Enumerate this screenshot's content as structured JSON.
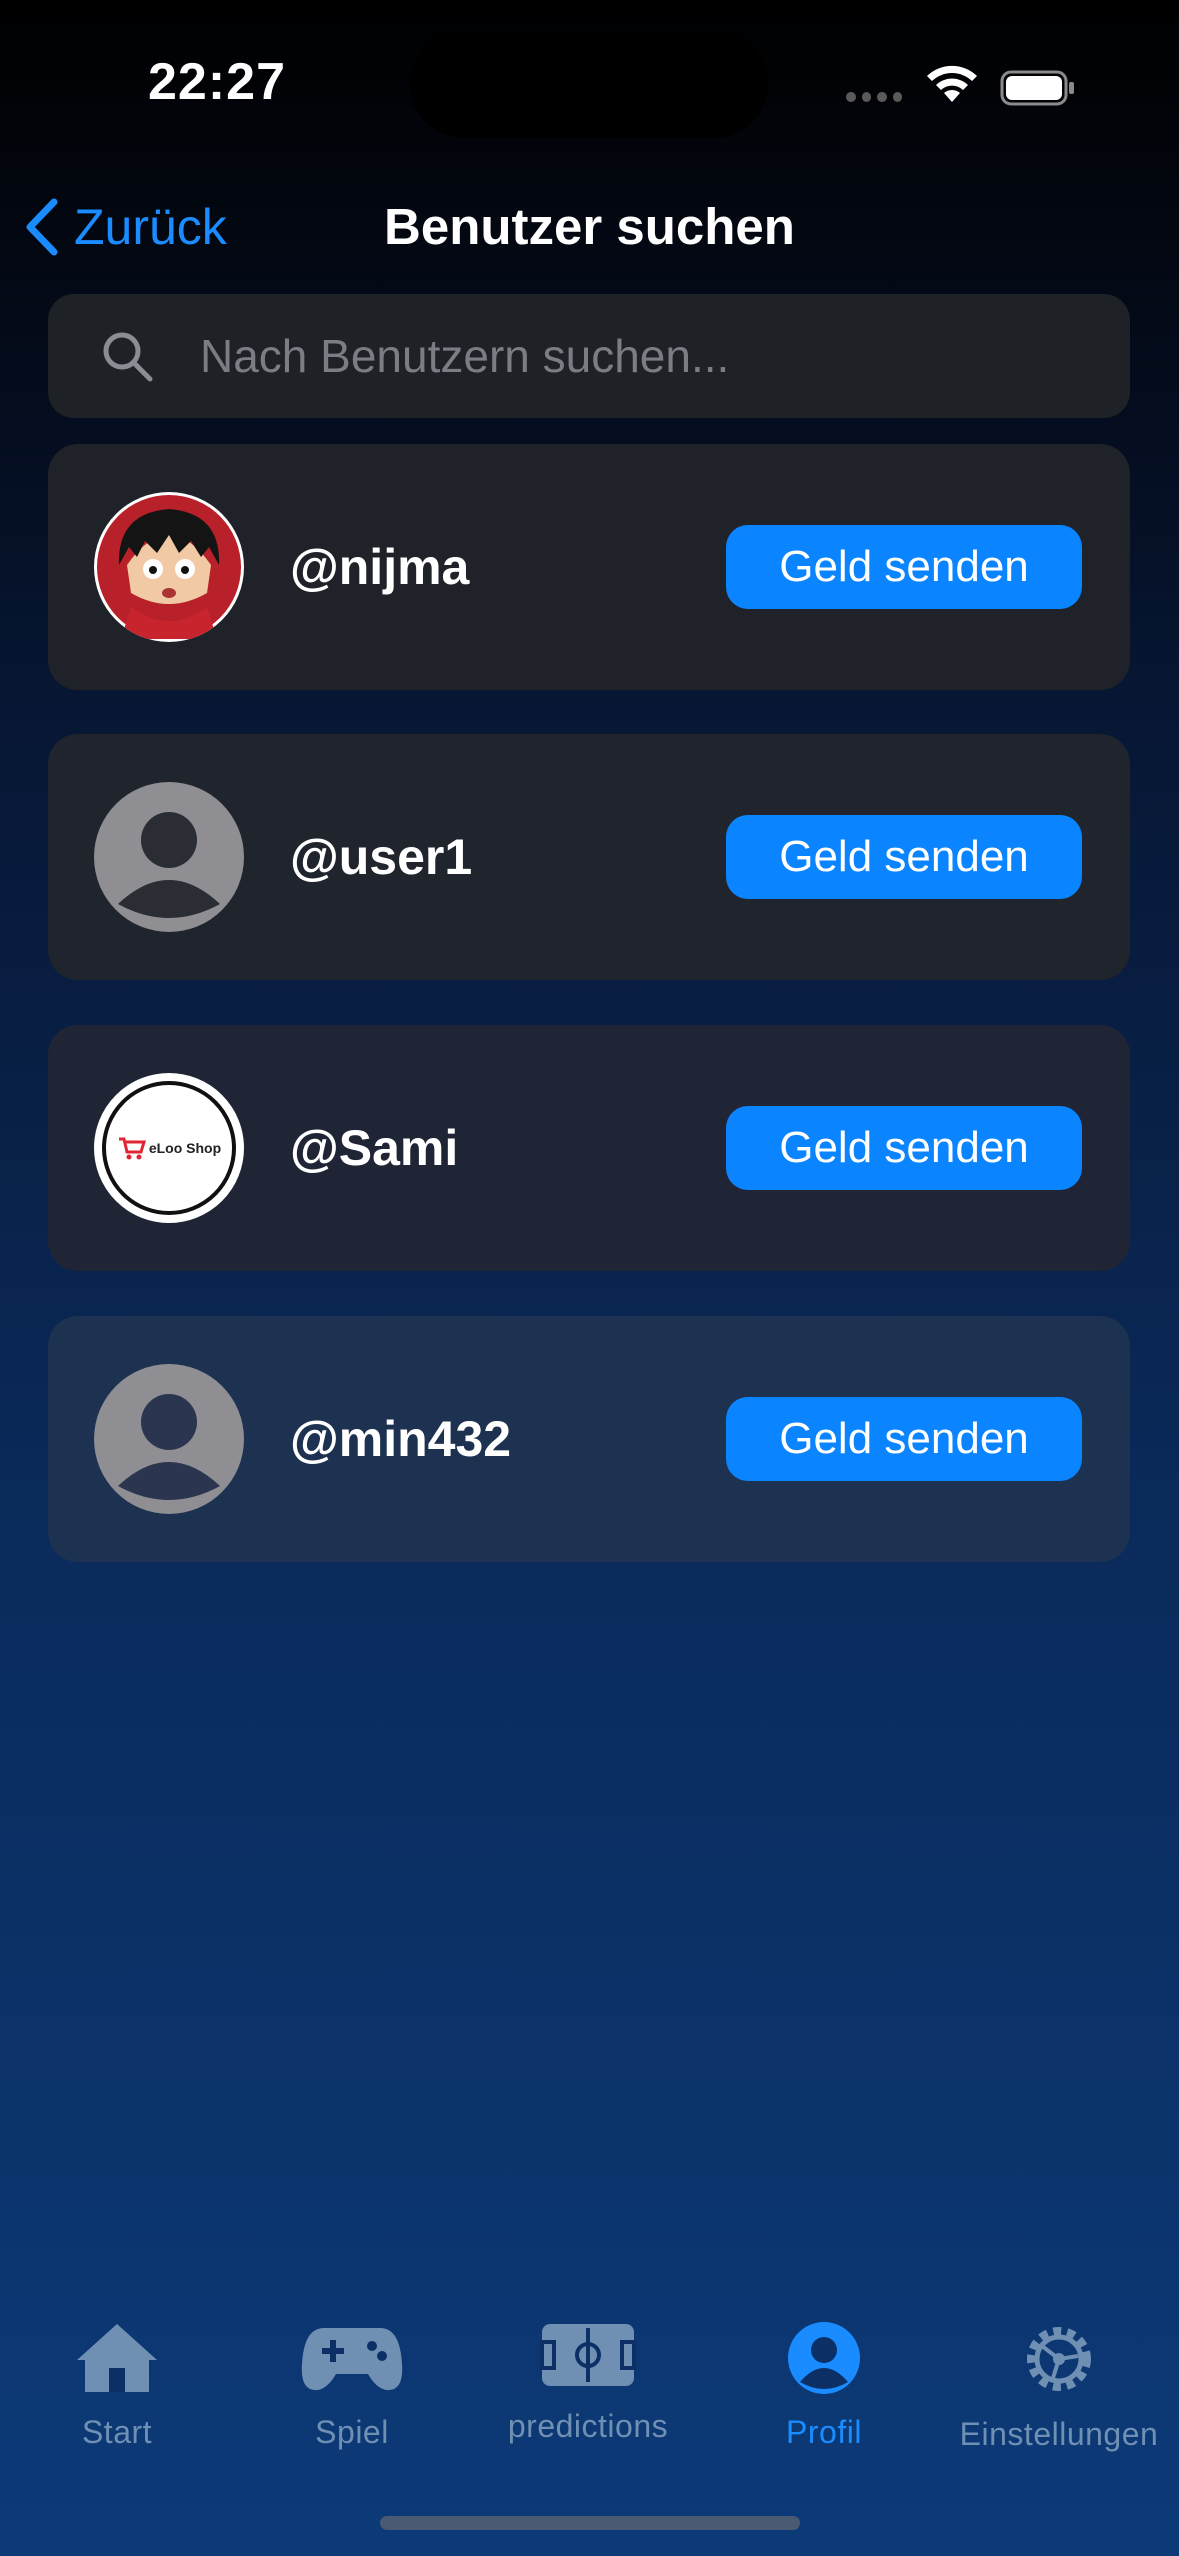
{
  "status_bar": {
    "time": "22:27"
  },
  "nav": {
    "back_label": "Zurück",
    "title": "Benutzer suchen"
  },
  "search": {
    "placeholder": "Nach Benutzern suchen..."
  },
  "users": [
    {
      "username": "@nijma",
      "avatar": "anime-avatar",
      "button_label": "Geld senden"
    },
    {
      "username": "@user1",
      "avatar": "default-avatar",
      "button_label": "Geld senden"
    },
    {
      "username": "@Sami",
      "avatar": "eloo-shop-logo",
      "logo_text": "eLoo Shop",
      "button_label": "Geld senden"
    },
    {
      "username": "@min432",
      "avatar": "default-avatar",
      "button_label": "Geld senden"
    }
  ],
  "tab_bar": {
    "active": "Profil",
    "items": [
      {
        "label": "Start",
        "icon": "house-icon"
      },
      {
        "label": "Spiel",
        "icon": "gamecontroller-icon"
      },
      {
        "label": "predictions",
        "icon": "soccer-field-icon"
      },
      {
        "label": "Profil",
        "icon": "person-circle-icon"
      },
      {
        "label": "Einstellungen",
        "icon": "gear-icon"
      }
    ]
  },
  "colors": {
    "accent": "#0a84ff",
    "card": "#1e2126",
    "inactive_tab": "#6f8fb3"
  }
}
